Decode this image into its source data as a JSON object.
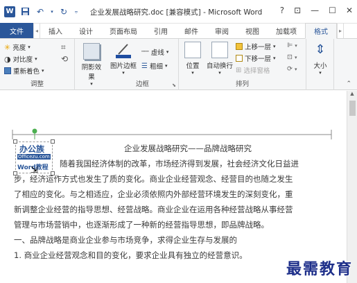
{
  "window": {
    "title": "企业发展战略研究.doc [兼容模式] - Microsoft Word",
    "help": "?",
    "controls": [
      "⊡",
      "—",
      "☐",
      "✕"
    ]
  },
  "tabs": [
    {
      "label": "文件"
    },
    {
      "label": "插入"
    },
    {
      "label": "设计"
    },
    {
      "label": "页面布局"
    },
    {
      "label": "引用"
    },
    {
      "label": "邮件"
    },
    {
      "label": "审阅"
    },
    {
      "label": "视图"
    },
    {
      "label": "加载项"
    },
    {
      "label": "格式"
    }
  ],
  "ribbon": {
    "adjust": {
      "label": "调整",
      "brightness": "亮度",
      "contrast": "对比度",
      "recolor": "重新着色",
      "compress_icon": "compress-icon",
      "reset_icon": "reset-picture-icon"
    },
    "shadow": {
      "label": "阴影效果"
    },
    "border": {
      "label": "边框",
      "picture_border": "图片边框",
      "dashes": "虚线",
      "weight": "粗细",
      "border_color": "#1f4ea1"
    },
    "arrange": {
      "label": "排列",
      "position": "位置",
      "wrap_text": "自动换行",
      "bring_forward": "上移一层",
      "send_backward": "下移一层",
      "selection_pane": "选择窗格"
    },
    "size": {
      "label": "大小"
    }
  },
  "document": {
    "heading": "企业发展战略研究——品牌战略研究",
    "lines": [
      "随着我国经济体制的改革，市场经济得到发展，社会经济文化日益进",
      "步，经济运作方式也发生了质的变化。商业企业经营观念、经营目的也随之发生",
      "了相应的变化。与之相适应，企业必须依照内外部经营环境发生的深刻变化，重",
      "新调整企业经营的指导思想、经营战略。商业企业在运用各种经营战略从事经营",
      "管理与市场营销中，也逐渐形成了一种新的经营指导思想，即品牌战略。",
      "一、品牌战略是商业企业参与市场竞争，求得企业生存与发展的",
      "1. 商业企业经营观念和目的变化，要求企业具有独立的经营意识。"
    ],
    "logo_text_top": "办公族",
    "logo_text_mid": "Officezu.com",
    "logo_text_bottom": "Word教程"
  },
  "watermark": "最需教育"
}
